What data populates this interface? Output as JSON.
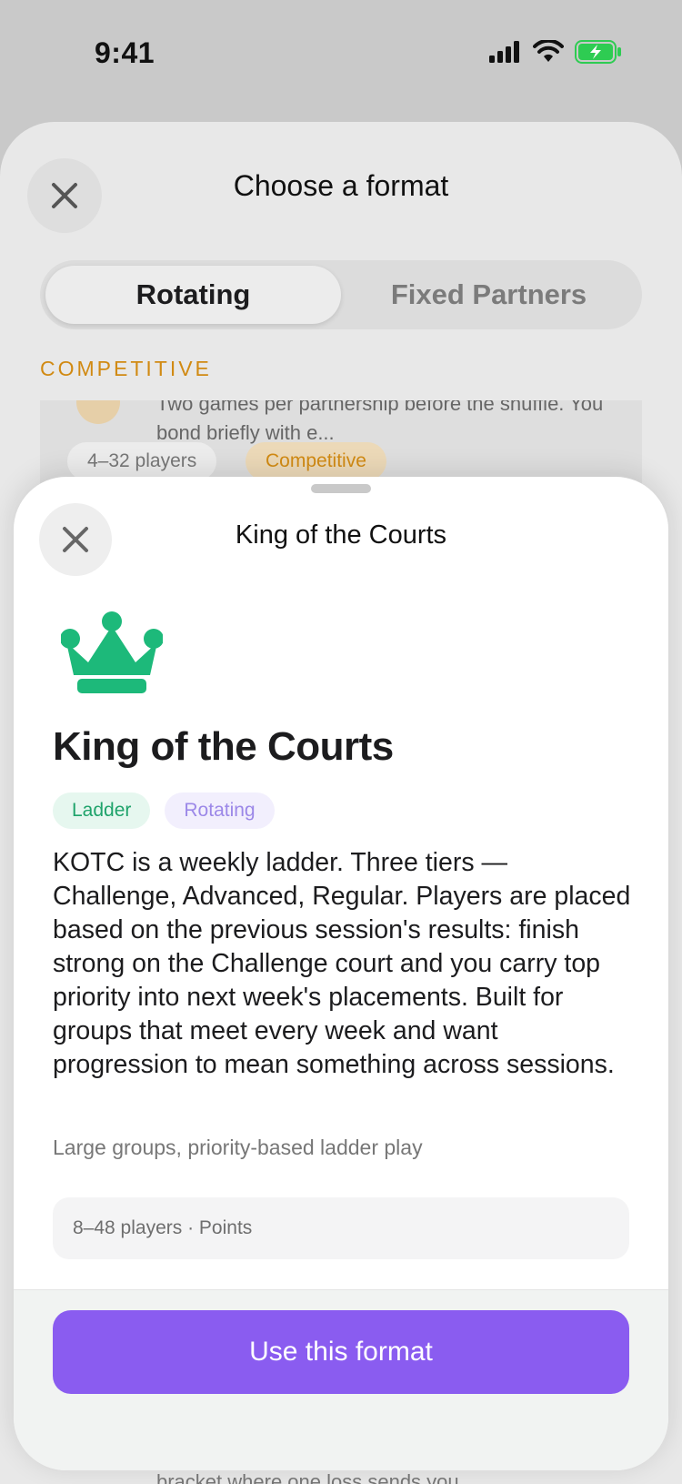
{
  "status_bar": {
    "time": "9:41"
  },
  "background": {
    "title": "Choose a format",
    "tabs": [
      "Rotating",
      "Fixed Partners"
    ],
    "section_label": "COMPETITIVE",
    "card_description": "Two games per partnership before the shuffle. You bond briefly with e...",
    "card_players": "4–32 players",
    "card_tag": "Competitive",
    "bottom_text": "bracket where one loss sends you"
  },
  "sheet": {
    "title": "King of the Courts",
    "icon": "crown-icon",
    "format_name": "King of the Courts",
    "tags": [
      "Ladder",
      "Rotating"
    ],
    "description": "KOTC is a weekly ladder. Three tiers — Challenge, Advanced, Regular. Players are placed based on the previous session's results: finish strong on the Challenge court and you carry top priority into next week's placements. Built for groups that meet every week and want progression to mean something across sessions.",
    "best_for": "Large groups, priority-based ladder play",
    "meta": "8–48 players · Points",
    "cta_label": "Use this format"
  },
  "colors": {
    "accent": "#8A5CF0",
    "crown": "#1DB97A",
    "ladder_tag": "#1FA36B",
    "rotating_tag": "#9C88E8",
    "competitive": "#D18A13"
  }
}
